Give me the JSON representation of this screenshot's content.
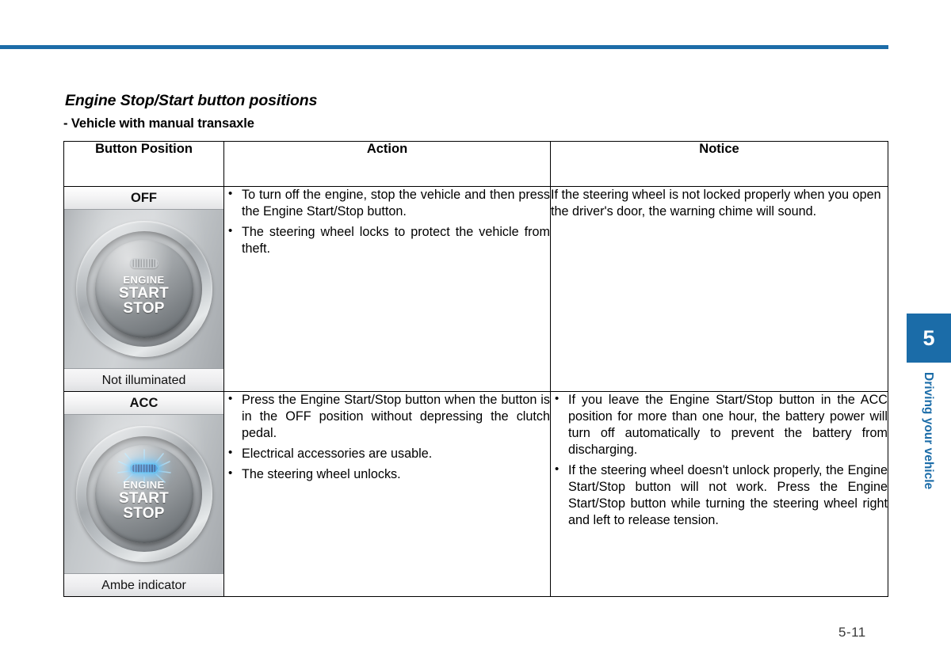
{
  "page": {
    "number": "5-11",
    "accent_color": "#1b6ca8",
    "rule_color": "#1c6ca8"
  },
  "headings": {
    "title": "Engine Stop/Start button positions",
    "subtitle": "- Vehicle with manual transaxle"
  },
  "table": {
    "columns": [
      "Button Position",
      "Action",
      "Notice"
    ],
    "rows": [
      {
        "position": {
          "state_label": "OFF",
          "caption": "Not illuminated",
          "button_text": {
            "line1": "ENGINE",
            "line2": "START",
            "line3": "STOP"
          },
          "indicator": "unlit"
        },
        "action": {
          "type": "bullets",
          "items": [
            "To turn off the engine, stop the vehicle and then press the Engine Start/Stop button.",
            "The steering wheel locks to protect the vehicle from theft."
          ]
        },
        "notice": {
          "type": "paragraph",
          "items": [
            "If the steering wheel is not locked properly when you open the driver's door, the warning chime will sound."
          ]
        }
      },
      {
        "position": {
          "state_label": "ACC",
          "caption": "Ambe indicator",
          "button_text": {
            "line1": "ENGINE",
            "line2": "START",
            "line3": "STOP"
          },
          "indicator": "lit"
        },
        "action": {
          "type": "bullets",
          "items": [
            "Press the Engine Start/Stop button when the button is in the OFF position without depressing the clutch pedal.",
            "Electrical accessories are usable.",
            "The steering wheel unlocks."
          ]
        },
        "notice": {
          "type": "bullets",
          "items": [
            "If you leave the Engine Start/Stop button in the ACC position for more than one hour, the battery power will turn off automatically to prevent the battery from discharging.",
            "If the steering wheel doesn't unlock properly, the Engine Start/Stop button will not work. Press the Engine Start/Stop button while turning the steering wheel right and left to release tension."
          ]
        }
      }
    ]
  },
  "side_tab": {
    "chapter_number": "5",
    "chapter_label": "Driving your vehicle"
  }
}
